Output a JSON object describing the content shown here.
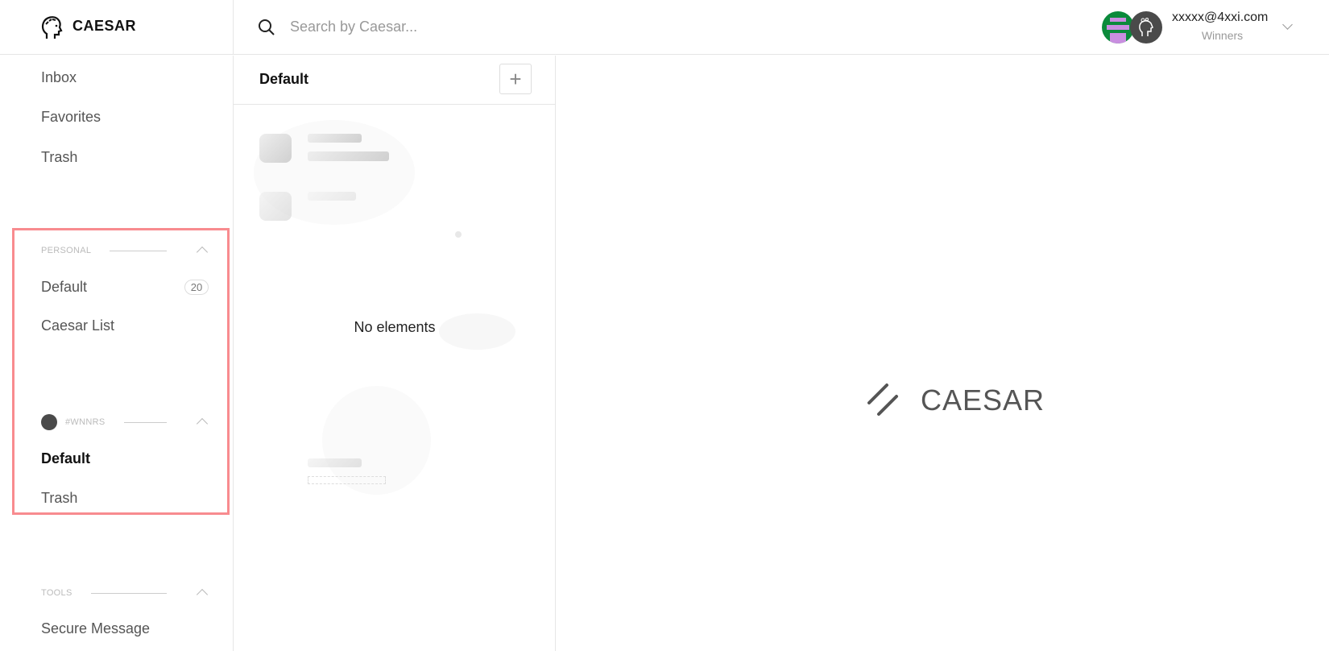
{
  "brand": {
    "name": "CAESAR",
    "icon": "caesar-head-icon"
  },
  "search": {
    "placeholder": "Search by Caesar...",
    "icon": "search-icon"
  },
  "account": {
    "email": "xxxxx@4xxi.com",
    "organization": "Winners",
    "icon": "chevron-down-icon"
  },
  "sidebar": {
    "top_items": [
      {
        "label": "Inbox"
      },
      {
        "label": "Favorites"
      },
      {
        "label": "Trash"
      }
    ],
    "personal": {
      "title": "PERSONAL",
      "items": [
        {
          "label": "Default",
          "count": "20"
        },
        {
          "label": "Caesar List"
        }
      ]
    },
    "team": {
      "title": "#WNNRS",
      "items": [
        {
          "label": "Default",
          "active": true
        },
        {
          "label": "Trash"
        }
      ]
    },
    "tools": {
      "title": "TOOLS",
      "items": [
        {
          "label": "Secure Message"
        }
      ]
    },
    "highlight_color": "#f88b8f"
  },
  "list": {
    "title": "Default",
    "add_label": "+",
    "empty_text": "No elements"
  },
  "main": {
    "logo_text": "CAESAR"
  }
}
